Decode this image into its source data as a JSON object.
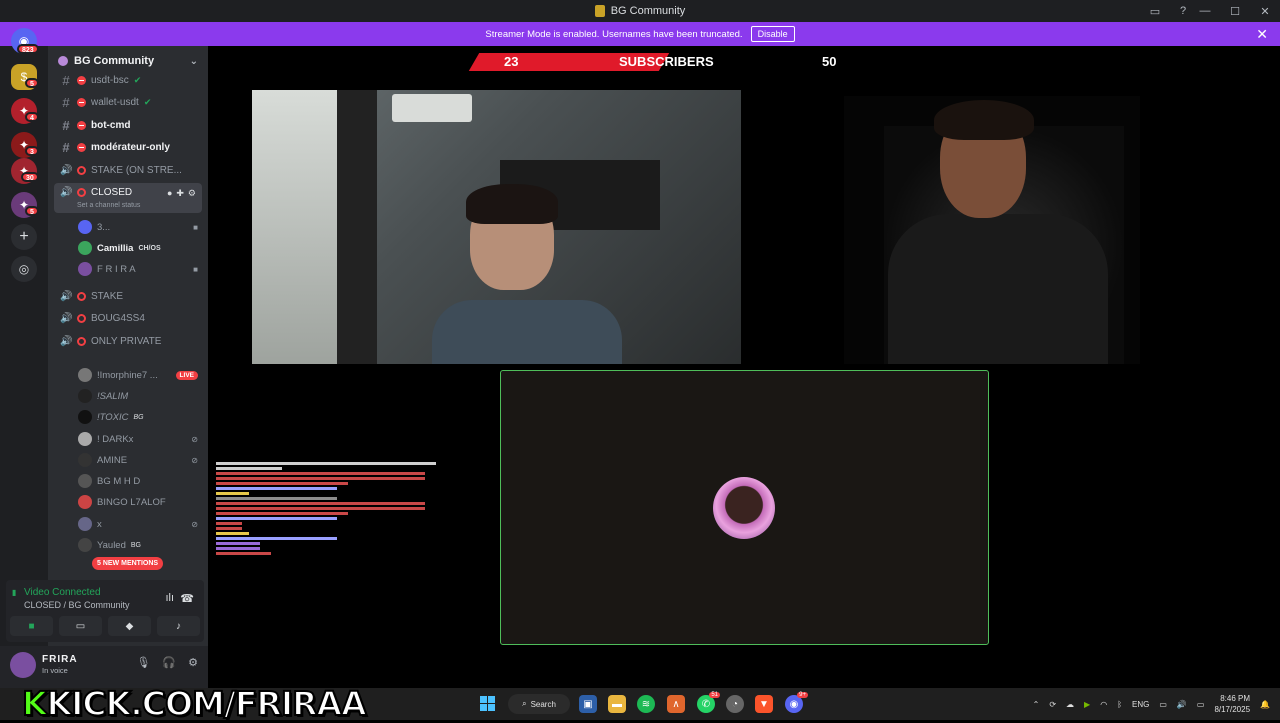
{
  "window": {
    "title": "BG Community"
  },
  "banner": {
    "text": "Streamer Mode is enabled. Usernames have been truncated.",
    "button": "Disable"
  },
  "servers": [
    {
      "badge": "823",
      "color": "#5865f2"
    },
    {
      "badge": "5",
      "color": "#c9a227"
    },
    {
      "badge": "4",
      "color": "#b3202c"
    },
    {
      "badge": "3",
      "color": "#8b1a1a"
    },
    {
      "badge": "30",
      "color": "#a02530"
    },
    {
      "badge": "5",
      "color": "#6a3b7a"
    }
  ],
  "guild": {
    "name": "BG Community"
  },
  "channels": [
    {
      "name": "usdt-bsc",
      "type": "text",
      "bold": false
    },
    {
      "name": "wallet-usdt",
      "type": "text",
      "bold": false
    },
    {
      "name": "bot-cmd",
      "type": "text",
      "bold": true
    },
    {
      "name": "modérateur-only",
      "type": "text",
      "bold": true
    },
    {
      "name": "STAKE (ON STRE...",
      "type": "voice",
      "bold": false
    },
    {
      "name": "CLOSED",
      "type": "voice",
      "bold": false,
      "active": true
    },
    {
      "name": "STAKE",
      "type": "voice",
      "bold": false
    },
    {
      "name": "BOUG4SS4",
      "type": "voice",
      "bold": false
    },
    {
      "name": "ONLY PRIVATE",
      "type": "voice",
      "bold": false
    }
  ],
  "channel_status_placeholder": "Set a channel status",
  "closed_users": [
    {
      "name": "3...",
      "color": "#5865f2"
    },
    {
      "name": "Camillia",
      "tag": "CH/OS",
      "color": "#3ba55d"
    },
    {
      "name": "F R I R A",
      "color": "#7a4fa0"
    }
  ],
  "private_users": [
    {
      "name": "!Imorphine7 ...",
      "live": "LIVE",
      "color": "#777"
    },
    {
      "name": "!SALIM",
      "color": "#222"
    },
    {
      "name": "!TOXIC",
      "tag": "BG",
      "color": "#111"
    },
    {
      "name": "! DARKx",
      "color": "#aaa"
    },
    {
      "name": "AMINE",
      "color": "#333"
    },
    {
      "name": "BG M H D",
      "color": "#555"
    },
    {
      "name": "BINGO L7ALOF",
      "color": "#c44"
    },
    {
      "name": "x",
      "color": "#668"
    },
    {
      "name": "Yauled",
      "tag": "BG",
      "color": "#444"
    }
  ],
  "mentions": "5 NEW MENTIONS",
  "voice": {
    "title": "Video Connected",
    "sub": "CLOSED / BG Community"
  },
  "user": {
    "name": "FRIRA",
    "status": "In voice"
  },
  "subscriber_bar": {
    "current": "23",
    "label": "SUBSCRIBERS",
    "goal": "50",
    "progress": 0.46
  },
  "watermark": {
    "k": "K",
    "rest": "KICK.COM/FRIRAA"
  },
  "taskbar": {
    "search": "Search",
    "apps": [
      {
        "icon": "capture-icon",
        "color": "#2d5fa8"
      },
      {
        "icon": "folder-icon",
        "color": "#e9b63f"
      },
      {
        "icon": "spotify-icon",
        "color": "#1db954"
      },
      {
        "icon": "app-icon",
        "color": "#e0662d"
      },
      {
        "icon": "whatsapp-icon",
        "color": "#25d366",
        "badge": "51"
      },
      {
        "icon": "app2-icon",
        "color": "#666"
      },
      {
        "icon": "brave-icon",
        "color": "#fb542b"
      },
      {
        "icon": "discord-icon",
        "color": "#5865f2",
        "badge": "9+"
      }
    ],
    "lang": "ENG",
    "time": "8:46 PM",
    "date": "8/17/2025"
  }
}
